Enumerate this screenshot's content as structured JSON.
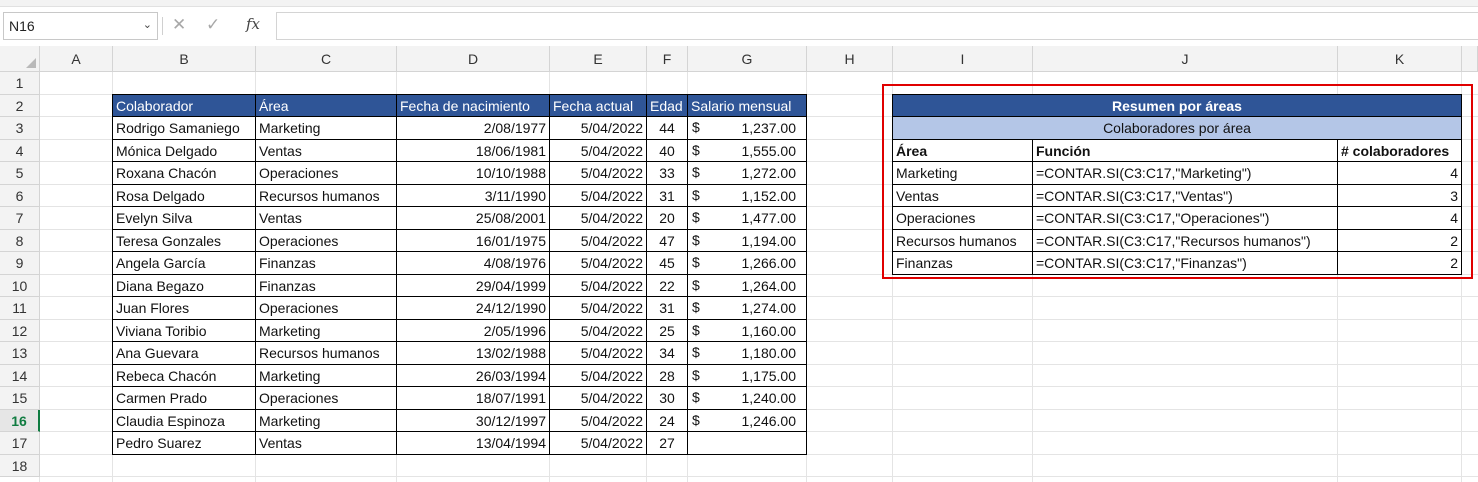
{
  "formula_bar": {
    "name_box": "N16",
    "formula": ""
  },
  "columns": [
    "A",
    "B",
    "C",
    "D",
    "E",
    "F",
    "G",
    "H",
    "I",
    "J",
    "K"
  ],
  "rows": [
    "1",
    "2",
    "3",
    "4",
    "5",
    "6",
    "7",
    "8",
    "9",
    "10",
    "11",
    "12",
    "13",
    "14",
    "15",
    "16",
    "17",
    "18"
  ],
  "selected_row": "16",
  "main_table": {
    "headers": [
      "Colaborador",
      "Área",
      "Fecha de nacimiento",
      "Fecha actual",
      "Edad",
      "Salario mensual"
    ],
    "currency_symbol": "$",
    "rows": [
      [
        "Rodrigo Samaniego",
        "Marketing",
        "2/08/1977",
        "5/04/2022",
        "44",
        "1,237.00"
      ],
      [
        "Mónica Delgado",
        "Ventas",
        "18/06/1981",
        "5/04/2022",
        "40",
        "1,555.00"
      ],
      [
        "Roxana Chacón",
        "Operaciones",
        "10/10/1988",
        "5/04/2022",
        "33",
        "1,272.00"
      ],
      [
        "Rosa Delgado",
        "Recursos humanos",
        "3/11/1990",
        "5/04/2022",
        "31",
        "1,152.00"
      ],
      [
        "Evelyn Silva",
        "Ventas",
        "25/08/2001",
        "5/04/2022",
        "20",
        "1,477.00"
      ],
      [
        "Teresa Gonzales",
        "Operaciones",
        "16/01/1975",
        "5/04/2022",
        "47",
        "1,194.00"
      ],
      [
        "Angela García",
        "Finanzas",
        "4/08/1976",
        "5/04/2022",
        "45",
        "1,266.00"
      ],
      [
        "Diana Begazo",
        "Finanzas",
        "29/04/1999",
        "5/04/2022",
        "22",
        "1,264.00"
      ],
      [
        "Juan Flores",
        "Operaciones",
        "24/12/1990",
        "5/04/2022",
        "31",
        "1,274.00"
      ],
      [
        "Viviana Toribio",
        "Marketing",
        "2/05/1996",
        "5/04/2022",
        "25",
        "1,160.00"
      ],
      [
        "Ana Guevara",
        "Recursos humanos",
        "13/02/1988",
        "5/04/2022",
        "34",
        "1,180.00"
      ],
      [
        "Rebeca Chacón",
        "Marketing",
        "26/03/1994",
        "5/04/2022",
        "28",
        "1,175.00"
      ],
      [
        "Carmen Prado",
        "Operaciones",
        "18/07/1991",
        "5/04/2022",
        "30",
        "1,240.00"
      ],
      [
        "Claudia Espinoza",
        "Marketing",
        "30/12/1997",
        "5/04/2022",
        "24",
        "1,246.00"
      ],
      [
        "Pedro Suarez",
        "Ventas",
        "13/04/1994",
        "5/04/2022",
        "27",
        ""
      ]
    ]
  },
  "summary_table": {
    "title": "Resumen por áreas",
    "subtitle": "Colaboradores por área",
    "headers": [
      "Área",
      "Función",
      "# colaboradores"
    ],
    "rows": [
      [
        "Marketing",
        "=CONTAR.SI(C3:C17,\"Marketing\")",
        "4"
      ],
      [
        "Ventas",
        "=CONTAR.SI(C3:C17,\"Ventas\")",
        "3"
      ],
      [
        "Operaciones",
        "=CONTAR.SI(C3:C17,\"Operaciones\")",
        "4"
      ],
      [
        "Recursos humanos",
        "=CONTAR.SI(C3:C17,\"Recursos humanos\")",
        "2"
      ],
      [
        "Finanzas",
        "=CONTAR.SI(C3:C17,\"Finanzas\")",
        "2"
      ]
    ]
  },
  "colors": {
    "header_fill": "#2f5597",
    "subheader_fill": "#b4c6e7",
    "highlight_border": "#e00000",
    "selection": "#107c41"
  }
}
